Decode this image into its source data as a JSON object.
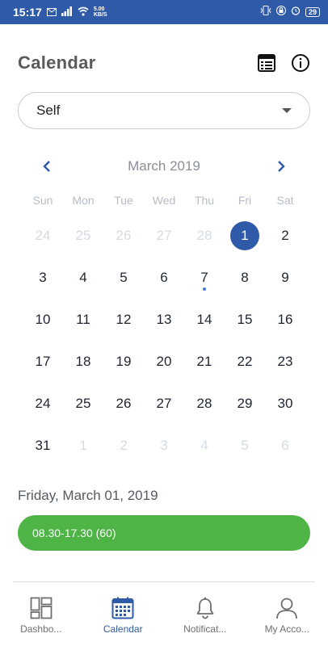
{
  "status_bar": {
    "time": "15:17",
    "speed_value": "5.00",
    "speed_unit": "KB/S",
    "battery": "29"
  },
  "header": {
    "title": "Calendar",
    "icons": [
      "list-calendar-icon",
      "info-icon"
    ]
  },
  "selector": {
    "value": "Self"
  },
  "calendar": {
    "month_label": "March 2019",
    "weekdays": [
      "Sun",
      "Mon",
      "Tue",
      "Wed",
      "Thu",
      "Fri",
      "Sat"
    ],
    "days": [
      {
        "label": "24",
        "muted": true
      },
      {
        "label": "25",
        "muted": true
      },
      {
        "label": "26",
        "muted": true
      },
      {
        "label": "27",
        "muted": true
      },
      {
        "label": "28",
        "muted": true
      },
      {
        "label": "1",
        "selected": true
      },
      {
        "label": "2"
      },
      {
        "label": "3"
      },
      {
        "label": "4"
      },
      {
        "label": "5"
      },
      {
        "label": "6"
      },
      {
        "label": "7",
        "event_dot": true
      },
      {
        "label": "8"
      },
      {
        "label": "9"
      },
      {
        "label": "10"
      },
      {
        "label": "11"
      },
      {
        "label": "12"
      },
      {
        "label": "13"
      },
      {
        "label": "14"
      },
      {
        "label": "15"
      },
      {
        "label": "16"
      },
      {
        "label": "17"
      },
      {
        "label": "18"
      },
      {
        "label": "19"
      },
      {
        "label": "20"
      },
      {
        "label": "21"
      },
      {
        "label": "22"
      },
      {
        "label": "23"
      },
      {
        "label": "24"
      },
      {
        "label": "25"
      },
      {
        "label": "26"
      },
      {
        "label": "27"
      },
      {
        "label": "28"
      },
      {
        "label": "29"
      },
      {
        "label": "30"
      },
      {
        "label": "31"
      },
      {
        "label": "1",
        "muted": true
      },
      {
        "label": "2",
        "muted": true
      },
      {
        "label": "3",
        "muted": true
      },
      {
        "label": "4",
        "muted": true
      },
      {
        "label": "5",
        "muted": true
      },
      {
        "label": "6",
        "muted": true
      }
    ]
  },
  "selected_day": {
    "date_label": "Friday, March 01, 2019",
    "event_label": "08.30-17.30 (60)"
  },
  "bottom_nav": {
    "items": [
      {
        "label": "Dashbo...",
        "icon": "dashboard-icon",
        "active": false
      },
      {
        "label": "Calendar",
        "icon": "calendar-icon",
        "active": true
      },
      {
        "label": "Notificat...",
        "icon": "bell-icon",
        "active": false
      },
      {
        "label": "My Acco...",
        "icon": "user-icon",
        "active": false
      }
    ]
  },
  "colors": {
    "primary": "#2f5aa8",
    "event_green": "#4db445",
    "event_dot": "#3f7ae0"
  }
}
